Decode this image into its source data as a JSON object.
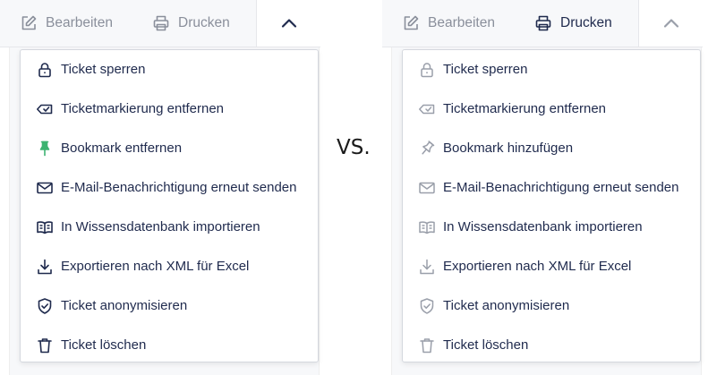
{
  "separator": "VS.",
  "colors": {
    "text_dark": "#1f2a4d",
    "toolbar_muted": "#8a8f9b",
    "icon_muted": "#9a9faa",
    "accent_green": "#3cb371"
  },
  "left": {
    "toolbar": {
      "edit_label": "Bearbeiten",
      "print_label": "Drucken"
    },
    "menu": [
      {
        "label": "Ticket sperren",
        "icon": "lock-icon"
      },
      {
        "label": "Ticketmarkierung entfernen",
        "icon": "tag-remove-icon"
      },
      {
        "label": "Bookmark entfernen",
        "icon": "pin-icon"
      },
      {
        "label": "E-Mail-Benachrichtigung erneut senden",
        "icon": "mail-icon"
      },
      {
        "label": "In Wissensdatenbank importieren",
        "icon": "book-icon"
      },
      {
        "label": "Exportieren nach XML für Excel",
        "icon": "download-icon"
      },
      {
        "label": "Ticket anonymisieren",
        "icon": "shield-check-icon"
      },
      {
        "label": "Ticket löschen",
        "icon": "trash-icon"
      }
    ]
  },
  "right": {
    "toolbar": {
      "edit_label": "Bearbeiten",
      "print_label": "Drucken"
    },
    "menu": [
      {
        "label": "Ticket sperren",
        "icon": "lock-icon"
      },
      {
        "label": "Ticketmarkierung entfernen",
        "icon": "tag-remove-icon"
      },
      {
        "label": "Bookmark hinzufügen",
        "icon": "pin-outline-icon"
      },
      {
        "label": "E-Mail-Benachrichtigung erneut senden",
        "icon": "mail-icon"
      },
      {
        "label": "In Wissensdatenbank importieren",
        "icon": "book-icon"
      },
      {
        "label": "Exportieren nach XML für Excel",
        "icon": "download-icon"
      },
      {
        "label": "Ticket anonymisieren",
        "icon": "shield-check-icon"
      },
      {
        "label": "Ticket löschen",
        "icon": "trash-icon"
      }
    ]
  }
}
